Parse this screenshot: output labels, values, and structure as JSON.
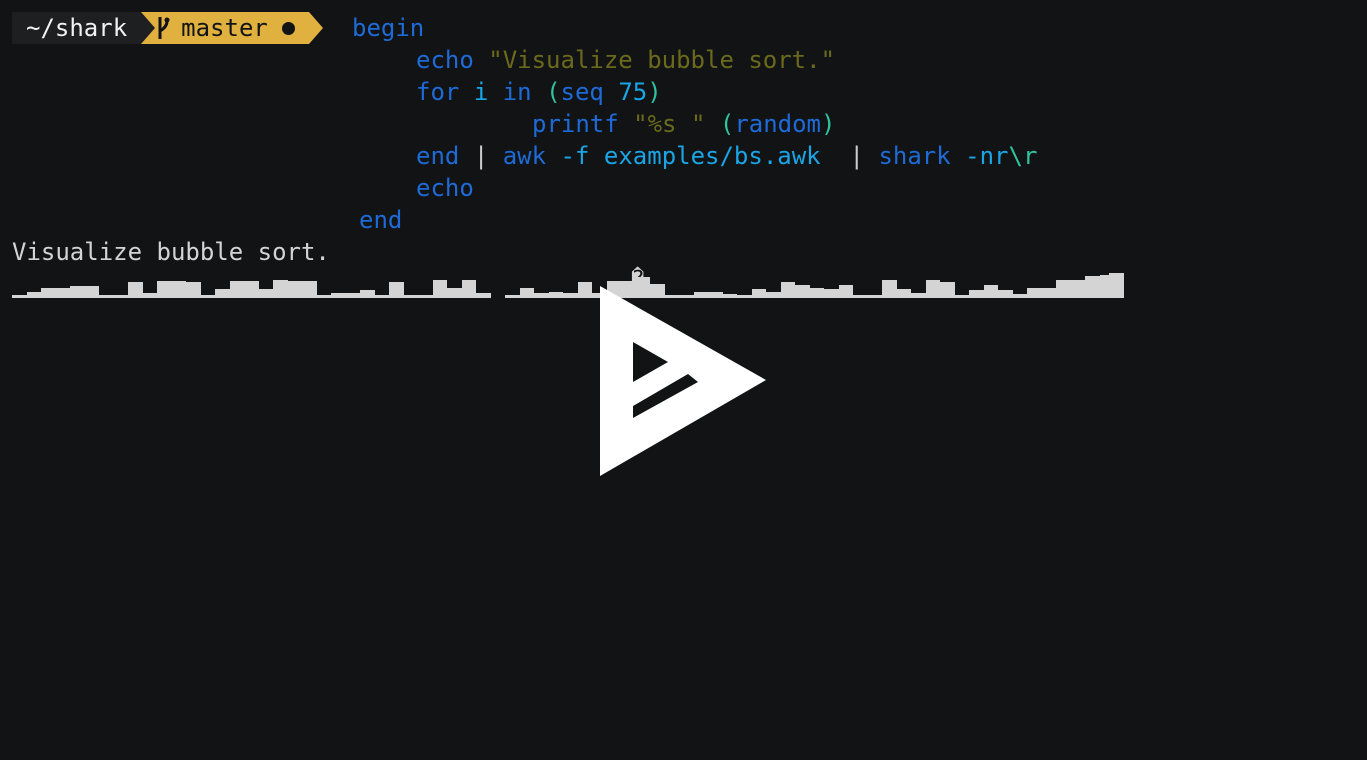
{
  "prompt": {
    "directory": "~/shark",
    "branch": "master",
    "branch_icon": "git-branch-icon",
    "dirty_icon": "dirty-dot-icon",
    "colors": {
      "dir_bg": "#1e1f20",
      "git_bg": "#e1b13f"
    }
  },
  "code": {
    "begin": "begin",
    "echo1_cmd": "echo",
    "echo1_str": "\"Visualize bubble sort.\"",
    "for_kw": "for",
    "for_var": "i",
    "in_kw": "in",
    "paren_open": "(",
    "seq_cmd": "seq",
    "seq_num": "75",
    "paren_close": ")",
    "printf_cmd": "printf",
    "printf_str": "\"%s \"",
    "random_cmd": "random",
    "end_kw": "end",
    "pipe1": "|",
    "awk_cmd": "awk",
    "awk_opt": "-f",
    "awk_arg": "examples/bs.awk",
    "pipe2": "|",
    "shark_cmd": "shark",
    "shark_opt": "-nr",
    "shark_esc": "\\r",
    "echo2_cmd": "echo",
    "end2_kw": "end"
  },
  "output": {
    "title": "Visualize bubble sort.",
    "replacement_char": "�",
    "bar_levels": [
      0.1,
      0.25,
      0.4,
      0.4,
      0.45,
      0.45,
      0.1,
      0.1,
      0.6,
      0.2,
      0.65,
      0.65,
      0.6,
      0.1,
      0.35,
      0.65,
      0.65,
      0.35,
      0.7,
      0.65,
      0.65,
      0.1,
      0.2,
      0.2,
      0.3,
      0.1,
      0.6,
      0.1,
      0.1,
      0.7,
      0.4,
      0.7,
      0.2,
      0.1,
      0.4,
      0.2,
      0.25,
      0.2,
      0.6,
      0.2,
      0.65,
      0.65,
      0.8,
      0.55,
      0.1,
      0.1,
      0.25,
      0.25,
      0.15,
      0.1,
      0.35,
      0.25,
      0.6,
      0.5,
      0.4,
      0.35,
      0.5,
      0.1,
      0.1,
      0.7,
      0.35,
      0.2,
      0.7,
      0.6,
      0.1,
      0.3,
      0.5,
      0.3,
      0.15,
      0.4,
      0.4,
      0.7,
      0.7,
      0.85,
      0.9
    ],
    "bars_after_gap": 33
  },
  "player": {
    "play_icon": "asciinema-play-icon",
    "colors": {
      "play": "#ffffff"
    }
  }
}
